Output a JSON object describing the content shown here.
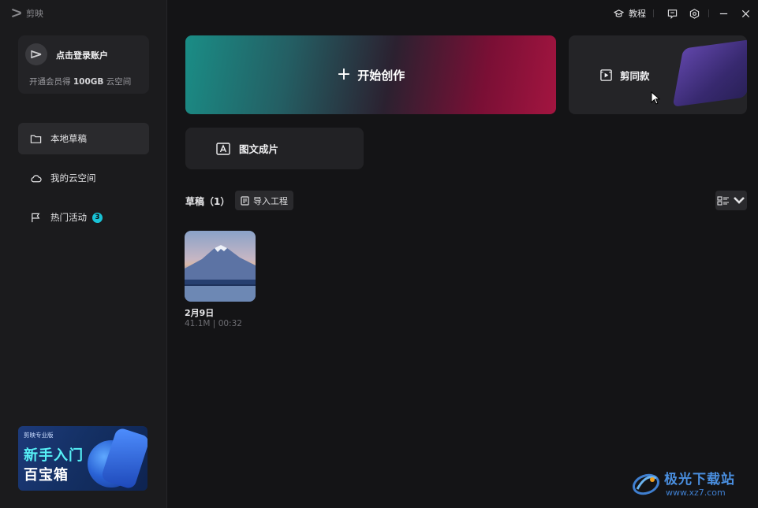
{
  "app": {
    "name": "剪映"
  },
  "account": {
    "login_label": "点击登录账户",
    "vip_prefix": "开通会员得",
    "vip_highlight": "100GB",
    "vip_suffix": "云空间"
  },
  "sidebar": {
    "items": [
      {
        "label": "本地草稿",
        "icon": "folder-icon",
        "active": true
      },
      {
        "label": "我的云空间",
        "icon": "cloud-icon",
        "active": false
      },
      {
        "label": "热门活动",
        "icon": "flag-icon",
        "active": false,
        "badge": "3"
      }
    ],
    "promo": {
      "brand": "剪映专业版",
      "title_line1": "新手入门",
      "title_line2": "百宝箱"
    }
  },
  "titlebar": {
    "tutorial_label": "教程",
    "icons": [
      "feedback-icon",
      "settings-icon",
      "minimize-icon",
      "close-icon"
    ]
  },
  "main": {
    "start_label": "开始创作",
    "template_label": "剪同款",
    "text_to_video_label": "图文成片",
    "drafts_title": "草稿（1）",
    "import_label": "导入工程"
  },
  "drafts": [
    {
      "name": "2月9日",
      "size": "41.1M",
      "duration": "00:32"
    }
  ],
  "watermark": {
    "title": "极光下载站",
    "url": "www.xz7.com"
  },
  "colors": {
    "accent": "#19c3d6",
    "background": "#141416",
    "sidebar": "#1b1b1d"
  }
}
